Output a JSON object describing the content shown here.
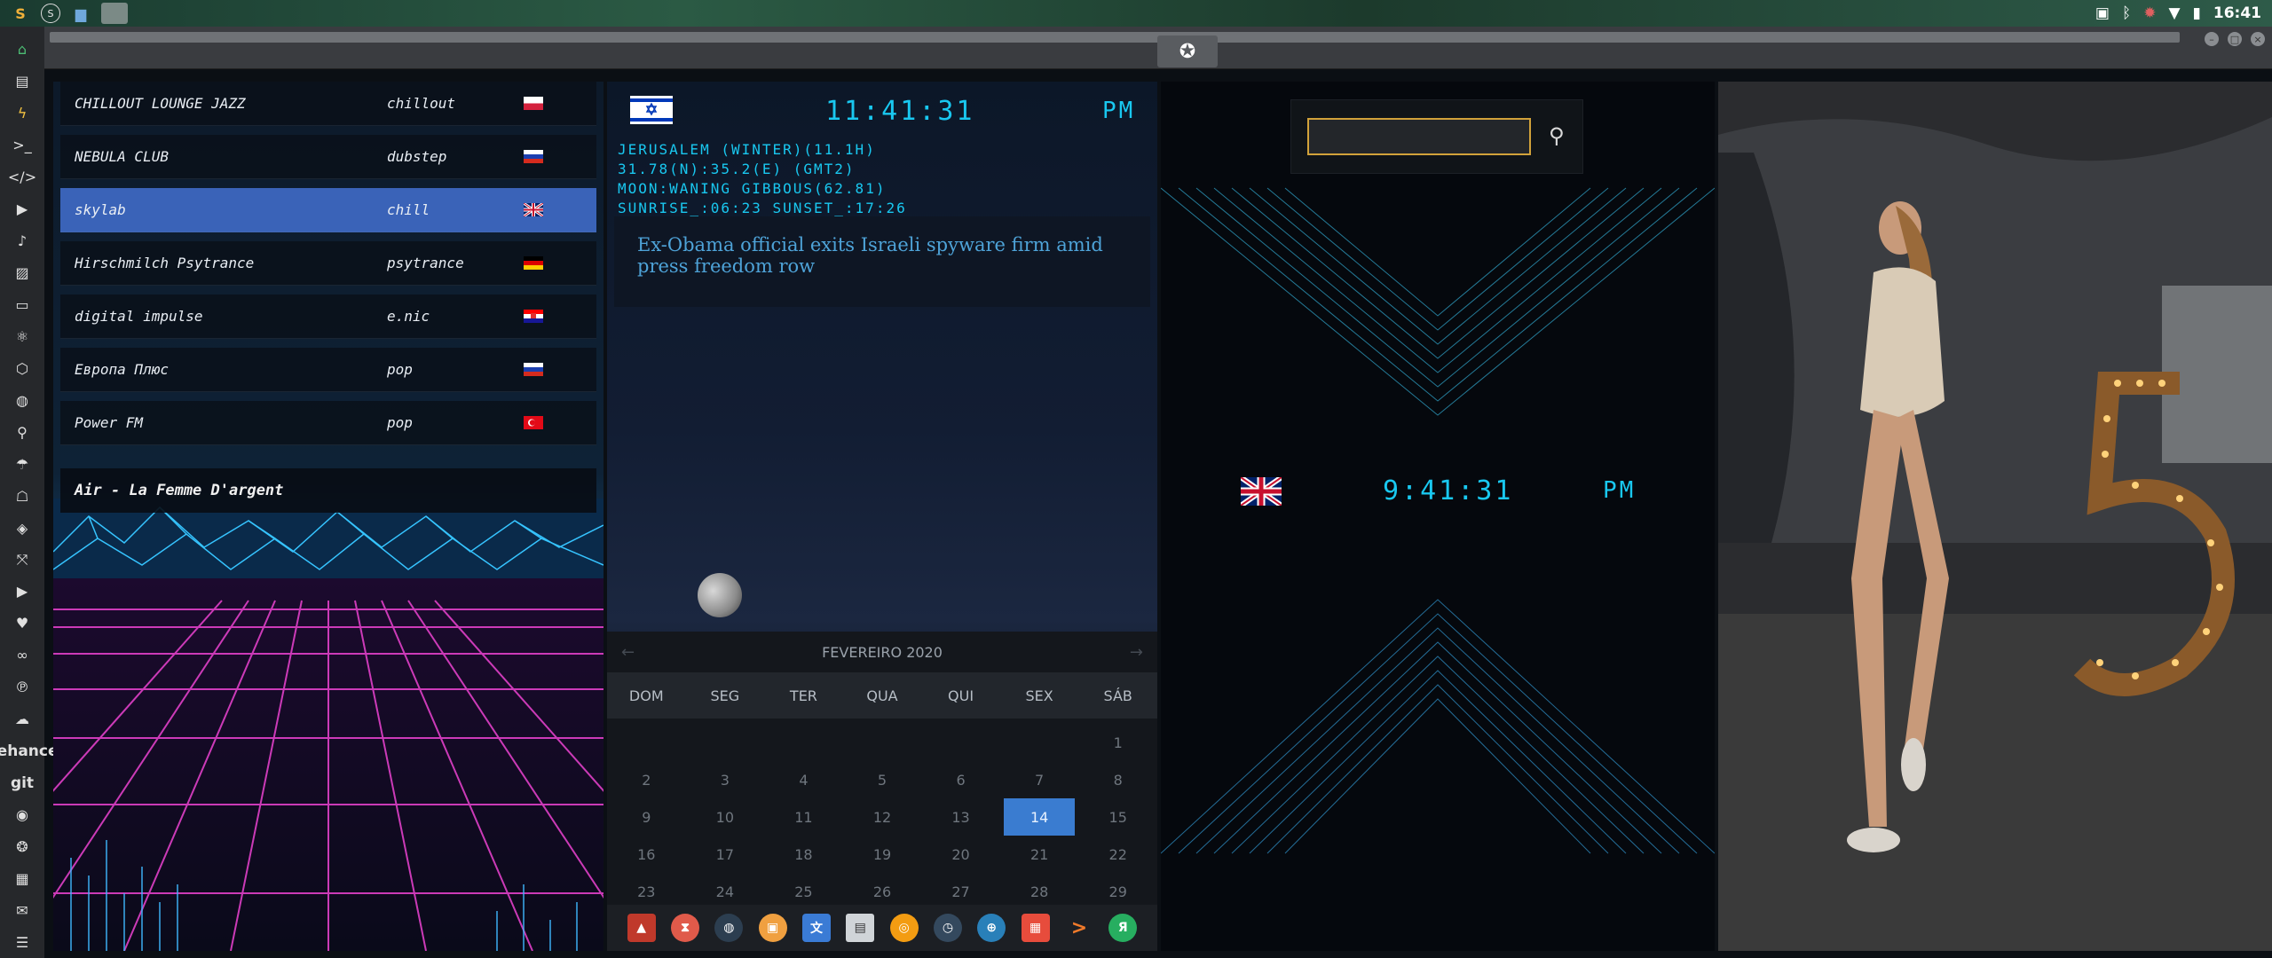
{
  "system": {
    "clock": "16:41",
    "tray_icons": [
      "image-icon",
      "bluetooth-icon",
      "bug-icon",
      "wifi-icon",
      "battery-icon"
    ]
  },
  "dock": [
    "home-icon",
    "file-icon",
    "bolt-icon",
    "terminal-icon",
    "code-icon",
    "play-icon",
    "music-icon",
    "image-icon",
    "id-card-icon",
    "react-icon",
    "hex-icon",
    "globe-icon",
    "search-icon",
    "umbrella-icon",
    "contact-icon",
    "tag-icon",
    "expand-icon",
    "youtube-icon",
    "heart-icon",
    "infinity-icon",
    "pinterest-icon",
    "cloud-icon",
    "behance",
    "git",
    "github-icon",
    "ubuntu-icon",
    "map-icon",
    "mail-icon",
    "list-icon"
  ],
  "radio": {
    "stations": [
      {
        "name": "CHILLOUT LOUNGE JAZZ",
        "genre": "chillout",
        "flag": "poland"
      },
      {
        "name": "NEBULA CLUB",
        "genre": "dubstep",
        "flag": "russia"
      },
      {
        "name": "skylab",
        "genre": "chill",
        "flag": "uk"
      },
      {
        "name": "Hirschmilch Psytrance",
        "genre": "psytrance",
        "flag": "germany"
      },
      {
        "name": "digital impulse",
        "genre": "e.nic",
        "flag": "croatia"
      },
      {
        "name": "Европа Плюс",
        "genre": "pop",
        "flag": "russia"
      },
      {
        "name": "Power FM",
        "genre": "pop",
        "flag": "turkey"
      }
    ],
    "selected_index": 2,
    "now_playing": "Air - La Femme D'argent"
  },
  "clock_main": {
    "time": "11:41:31",
    "ampm": "PM",
    "location": "JERUSALEM (WINTER)(11.1H)",
    "coords": "31.78(N):35.2(E) (GMT2)",
    "moon": "MOON:WANING GIBBOUS(62.81)",
    "sun": "SUNRISE_:06:23 SUNSET_:17:26"
  },
  "news": {
    "headline": "Ex-Obama official exits Israeli spyware firm amid press freedom row"
  },
  "calendar": {
    "title": "FEVEREIRO 2020",
    "prev": "←",
    "next": "→",
    "weekdays": [
      "DOM",
      "SEG",
      "TER",
      "QUA",
      "QUI",
      "SEX",
      "SÁB"
    ],
    "leading_blank": 6,
    "days": 29,
    "today": 14
  },
  "taskbar": [
    "warning-icon",
    "hourglass-icon",
    "planet-icon",
    "photos-icon",
    "translate-icon",
    "news-icon",
    "browser-icon",
    "clock-icon",
    "globe-icon",
    "calendar-icon",
    "arrow-icon",
    "yandex-icon"
  ],
  "search": {
    "value": "",
    "placeholder": ""
  },
  "world_clock": {
    "time": "9:41:31",
    "ampm": "PM",
    "flag": "uk"
  }
}
